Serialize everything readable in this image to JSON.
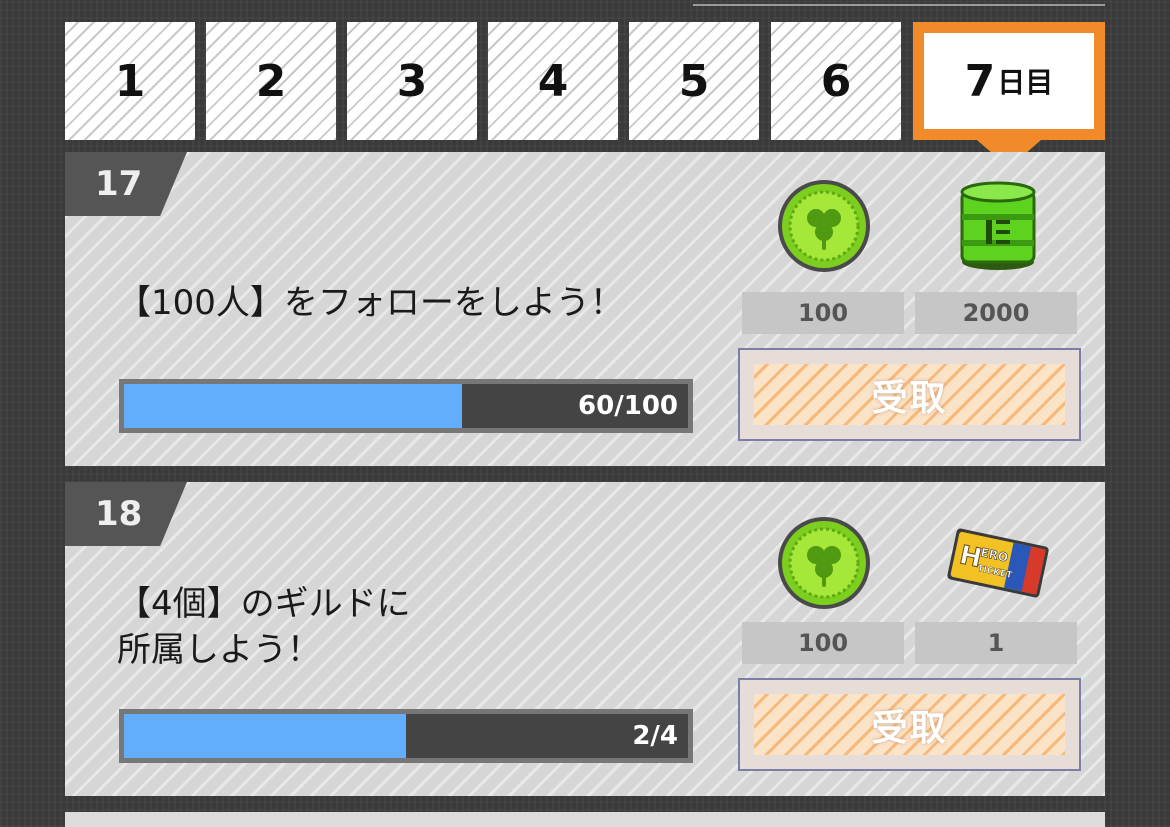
{
  "tabs": [
    {
      "label": "1",
      "active": false
    },
    {
      "label": "2",
      "active": false
    },
    {
      "label": "3",
      "active": false
    },
    {
      "label": "4",
      "active": false
    },
    {
      "label": "5",
      "active": false
    },
    {
      "label": "6",
      "active": false
    }
  ],
  "active_tab": {
    "number": "7",
    "suffix": "日目"
  },
  "accent_color": "#f08a2a",
  "missions": [
    {
      "number": "17",
      "text": "【100人】をフォローをしよう！",
      "progress_text": "60/100",
      "progress_fraction": 0.6,
      "rewards": [
        {
          "icon": "clover-coin-icon",
          "amount": "100"
        },
        {
          "icon": "green-barrel-icon",
          "amount": "2000"
        }
      ],
      "claim_label": "受取"
    },
    {
      "number": "18",
      "text": "【4個】のギルドに\n所属しよう！",
      "progress_text": "2/4",
      "progress_fraction": 0.5,
      "rewards": [
        {
          "icon": "clover-coin-icon",
          "amount": "100"
        },
        {
          "icon": "hero-ticket-icon",
          "amount": "1",
          "ticket_text": "HERO TICKET"
        }
      ],
      "claim_label": "受取"
    }
  ]
}
